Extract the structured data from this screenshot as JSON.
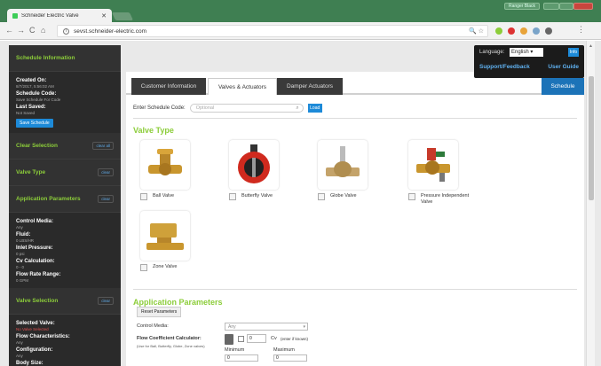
{
  "browser": {
    "tab_title": "Schneider Electric Valve",
    "tab_close": "✕",
    "url": "sevst.schneider-electric.com",
    "user_badge": "Ranger Black",
    "nav_back": "←",
    "nav_forward": "→",
    "nav_reload": "C",
    "nav_home": "⌂",
    "omnibox_icons": "🔍 ☆",
    "ext_colors": [
      "#8ccd3a",
      "#d33",
      "#e8a33a",
      "#7aa4c9",
      "#666"
    ]
  },
  "sidebar": {
    "schedule_info": {
      "heading": "Schedule Information",
      "created_label": "Created On:",
      "created_value": "8/7/2017, 5:56:02 AM",
      "code_label": "Schedule Code:",
      "code_value": "Save Schedule For Code",
      "saved_label": "Last Saved:",
      "saved_value": "Not Saved",
      "save_button": "Save Schedule"
    },
    "clear_selection": {
      "heading": "Clear Selection",
      "clear": "clear all"
    },
    "valve_type": {
      "heading": "Valve Type",
      "clear": "clear"
    },
    "app_params": {
      "heading": "Application Parameters",
      "clear": "clear",
      "items": [
        {
          "label": "Control Media:",
          "value": "Any"
        },
        {
          "label": "Fluid:",
          "value": "0 LBS/HR"
        },
        {
          "label": "Inlet Pressure:",
          "value": "0 psi"
        },
        {
          "label": "Cv Calculation:",
          "value": "0 - 0"
        },
        {
          "label": "Flow Rate Range:",
          "value": "0 GPM"
        }
      ]
    },
    "valve_selection": {
      "heading": "Valve Selection",
      "clear": "clear",
      "items": [
        {
          "label": "Selected Valve:",
          "value": "No Valve Selected",
          "red": true
        },
        {
          "label": "Flow Characteristics:",
          "value": "Any"
        },
        {
          "label": "Configuration:",
          "value": "Any"
        },
        {
          "label": "Body Size:",
          "value": ""
        }
      ]
    }
  },
  "language": {
    "label": "Language:",
    "selected": "English ▾",
    "info_button": "Info",
    "support": "Support/Feedback",
    "guide": "User Guide"
  },
  "tabs": {
    "customer": "Customer Information",
    "valves": "Valves & Actuators",
    "dampers": "Damper Actuators",
    "schedule": "Schedule"
  },
  "code_row": {
    "label": "Enter Schedule Code:",
    "placeholder": "Optional",
    "load": "Load"
  },
  "valve_type_section": {
    "title": "Valve Type",
    "valves": [
      {
        "label": "Ball Valve",
        "icon": "ball-valve-icon"
      },
      {
        "label": "Butterfly Valve",
        "icon": "butterfly-valve-icon"
      },
      {
        "label": "Globe Valve",
        "icon": "globe-valve-icon"
      },
      {
        "label": "Pressure Independent Valve",
        "icon": "piv-valve-icon"
      },
      {
        "label": "Zone Valve",
        "icon": "zone-valve-icon"
      }
    ]
  },
  "params_section": {
    "title": "Application Parameters",
    "reset": "Reset Parameters",
    "control_media_label": "Control Media:",
    "control_media_value": "Any",
    "select_arrow": "▾",
    "flow_coef_label": "Flow Coefficient Calculator:",
    "flow_coef_note": "(Use for Ball, Butterfly, Globe, Zone valves)",
    "cv_value": "0",
    "cv_label": "Cv",
    "cv_hint": "(enter if known)",
    "minimum": "Minimum",
    "maximum": "Maximum",
    "min_value": "0",
    "max_value": "0"
  },
  "colors": {
    "accent_green": "#8ccd3a",
    "accent_blue": "#1d8ad8",
    "chrome_green": "#3f7f52"
  }
}
